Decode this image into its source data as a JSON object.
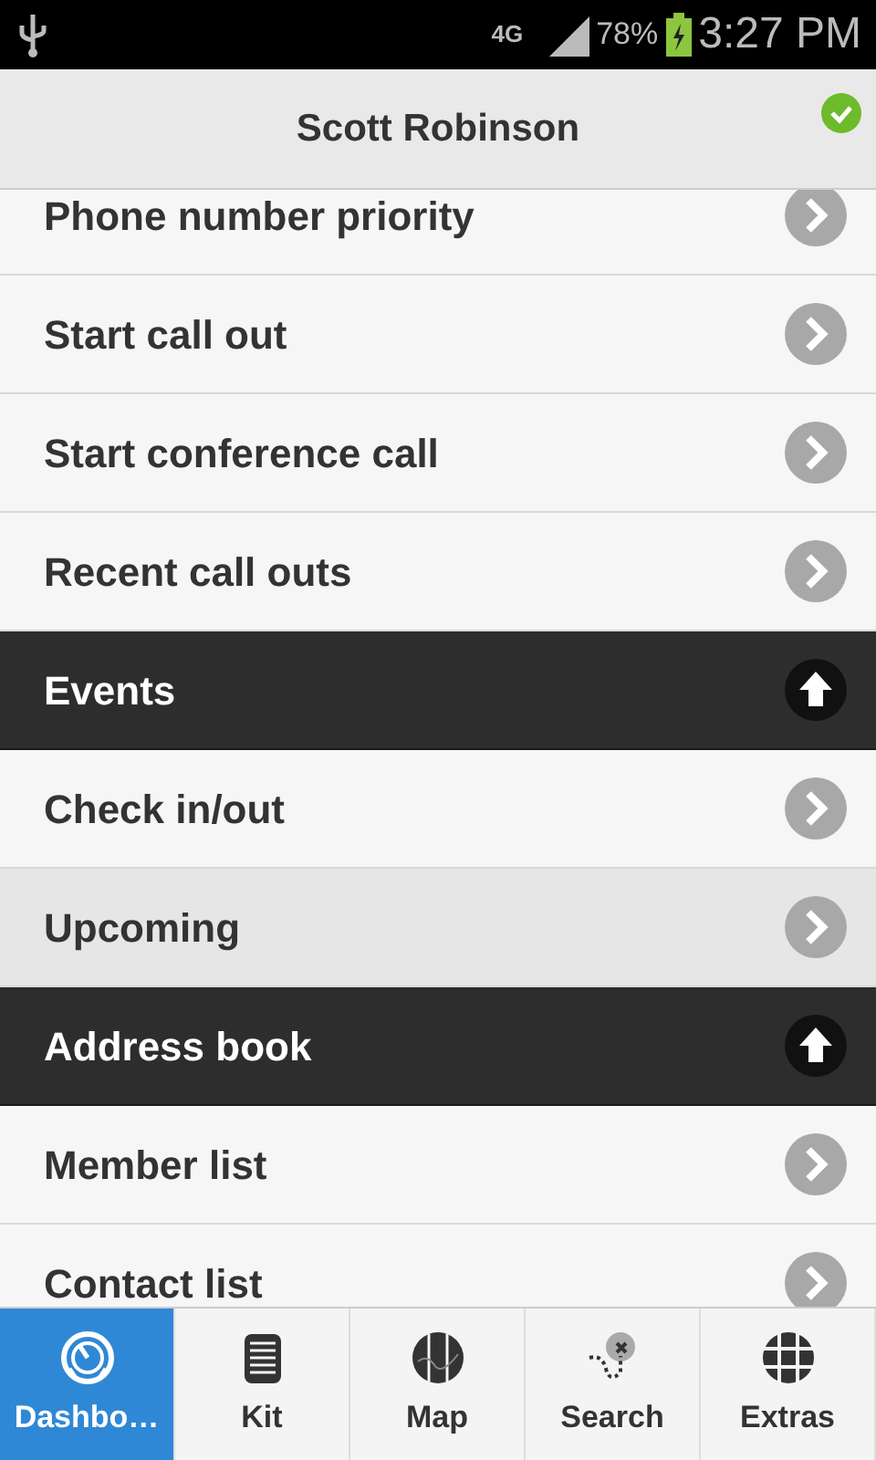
{
  "status_bar": {
    "network": "4G",
    "battery": "78%",
    "time": "3:27 PM"
  },
  "header": {
    "title": "Scott Robinson",
    "online": true
  },
  "list": [
    {
      "kind": "item",
      "label": "Phone number priority",
      "selected": false
    },
    {
      "kind": "item",
      "label": "Start call out",
      "selected": false
    },
    {
      "kind": "item",
      "label": "Start conference call",
      "selected": false
    },
    {
      "kind": "item",
      "label": "Recent call outs",
      "selected": false
    },
    {
      "kind": "section",
      "label": "Events"
    },
    {
      "kind": "item",
      "label": "Check in/out",
      "selected": false
    },
    {
      "kind": "item",
      "label": "Upcoming",
      "selected": true
    },
    {
      "kind": "section",
      "label": "Address book"
    },
    {
      "kind": "item",
      "label": "Member list",
      "selected": false
    },
    {
      "kind": "item",
      "label": "Contact list",
      "selected": false
    }
  ],
  "nav": [
    {
      "kind": "dashboard",
      "label": "Dashbo…",
      "selected": true
    },
    {
      "kind": "kit",
      "label": "Kit",
      "selected": false
    },
    {
      "kind": "map",
      "label": "Map",
      "selected": false
    },
    {
      "kind": "search",
      "label": "Search",
      "selected": false
    },
    {
      "kind": "extras",
      "label": "Extras",
      "selected": false
    }
  ]
}
